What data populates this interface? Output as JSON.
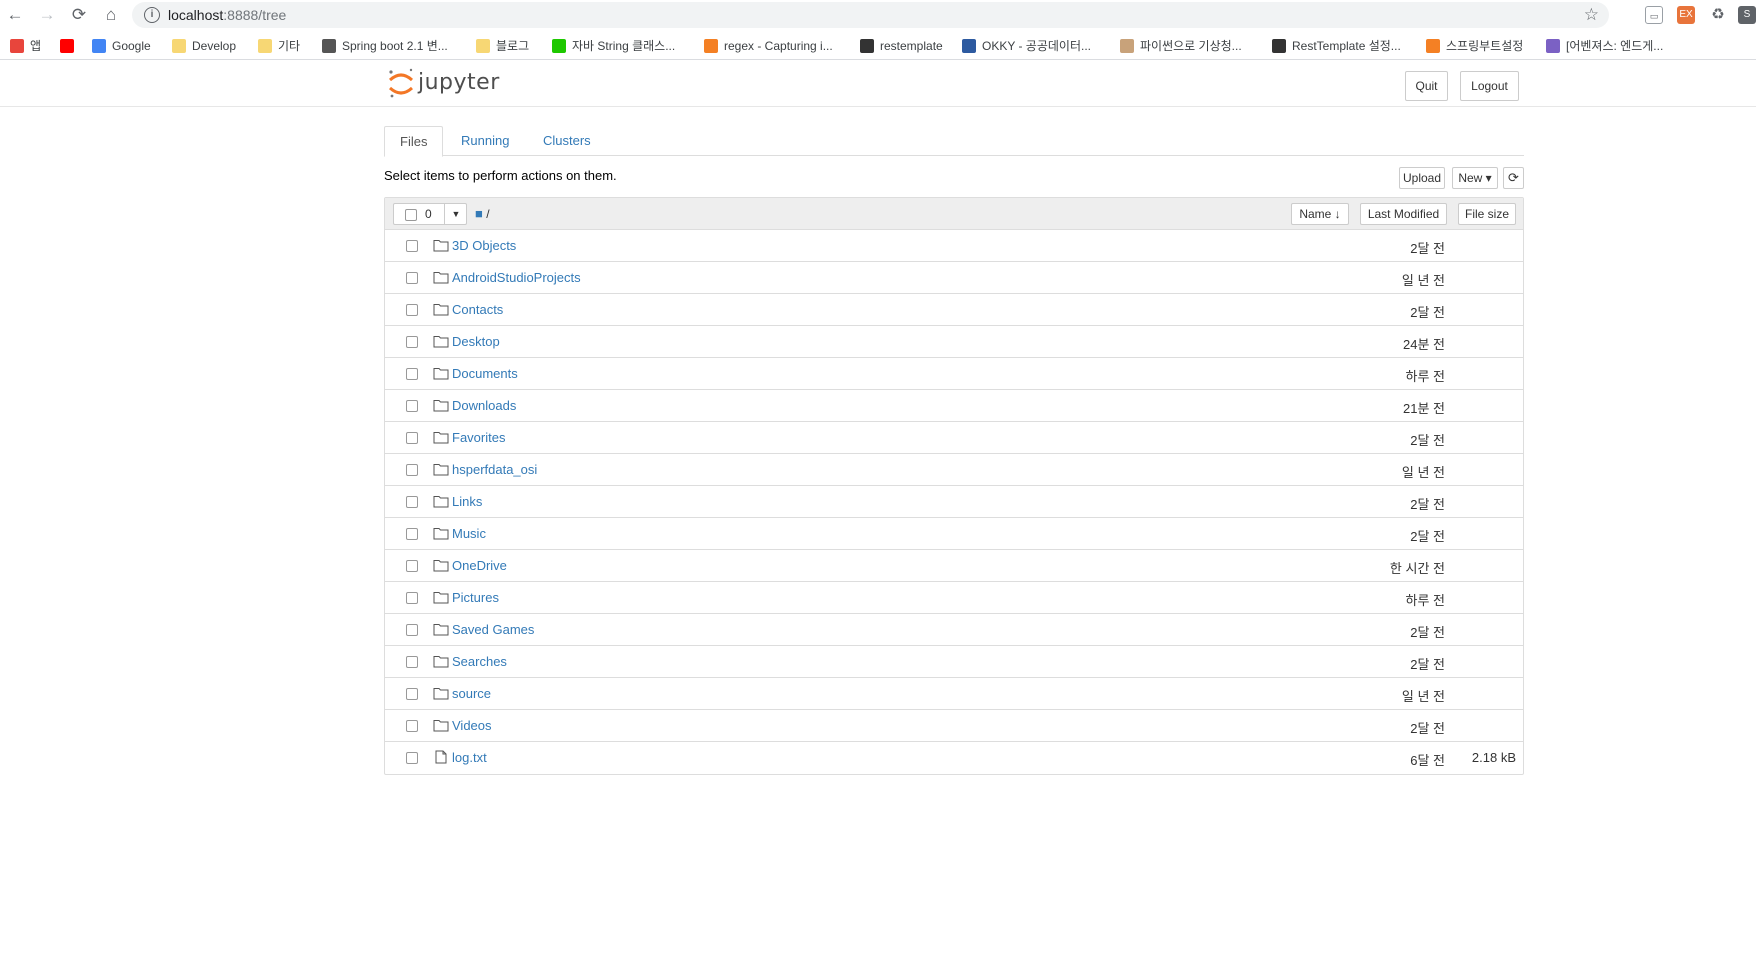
{
  "browser": {
    "url_host": "localhost",
    "url_rest": ":8888/tree",
    "bookmarks": [
      {
        "label": "앱",
        "icon": "apps-grid-icon",
        "color": "#e8453c"
      },
      {
        "label": "",
        "icon": "youtube-icon",
        "color": "#ff0000"
      },
      {
        "label": "Google",
        "icon": "google-icon",
        "color": "#4285f4"
      },
      {
        "label": "Develop",
        "icon": "folder-icon",
        "color": "#f7d774"
      },
      {
        "label": "기타",
        "icon": "folder-icon",
        "color": "#f7d774"
      },
      {
        "label": "Spring boot 2.1 변...",
        "icon": "globe-icon",
        "color": "#555555"
      },
      {
        "label": "블로그",
        "icon": "folder-icon",
        "color": "#f7d774"
      },
      {
        "label": "자바 String 클래스...",
        "icon": "naver-icon",
        "color": "#1ec800"
      },
      {
        "label": "regex - Capturing i...",
        "icon": "stackoverflow-icon",
        "color": "#f48024"
      },
      {
        "label": "restemplate",
        "icon": "tree-icon",
        "color": "#333333"
      },
      {
        "label": "OKKY - 공공데이터...",
        "icon": "okky-icon",
        "color": "#2d5aa0"
      },
      {
        "label": "파이썬으로 기상청...",
        "icon": "blog-icon",
        "color": "#c8a27a"
      },
      {
        "label": "RestTemplate 설정...",
        "icon": "tree-icon",
        "color": "#333333"
      },
      {
        "label": "스프링부트설정",
        "icon": "stackoverflow-icon",
        "color": "#f48024"
      },
      {
        "label": "[어벤져스: 엔드게...",
        "icon": "flower-icon",
        "color": "#7b61c4"
      }
    ]
  },
  "header": {
    "logo_text": "jupyter",
    "quit_label": "Quit",
    "logout_label": "Logout"
  },
  "tabs": [
    {
      "label": "Files",
      "active": true
    },
    {
      "label": "Running",
      "active": false
    },
    {
      "label": "Clusters",
      "active": false
    }
  ],
  "toolbar": {
    "instructions": "Select items to perform actions on them.",
    "upload_label": "Upload",
    "new_label": "New ▾",
    "refresh_icon": "refresh-icon"
  },
  "list": {
    "selected_count": "0",
    "breadcrumb": "/",
    "sort_name_label": "Name ↓",
    "sort_modified_label": "Last Modified",
    "sort_size_label": "File size",
    "rows": [
      {
        "type": "folder",
        "name": "3D Objects",
        "modified": "2달 전",
        "size": ""
      },
      {
        "type": "folder",
        "name": "AndroidStudioProjects",
        "modified": "일 년 전",
        "size": ""
      },
      {
        "type": "folder",
        "name": "Contacts",
        "modified": "2달 전",
        "size": ""
      },
      {
        "type": "folder",
        "name": "Desktop",
        "modified": "24분 전",
        "size": ""
      },
      {
        "type": "folder",
        "name": "Documents",
        "modified": "하루 전",
        "size": ""
      },
      {
        "type": "folder",
        "name": "Downloads",
        "modified": "21분 전",
        "size": ""
      },
      {
        "type": "folder",
        "name": "Favorites",
        "modified": "2달 전",
        "size": ""
      },
      {
        "type": "folder",
        "name": "hsperfdata_osi",
        "modified": "일 년 전",
        "size": ""
      },
      {
        "type": "folder",
        "name": "Links",
        "modified": "2달 전",
        "size": ""
      },
      {
        "type": "folder",
        "name": "Music",
        "modified": "2달 전",
        "size": ""
      },
      {
        "type": "folder",
        "name": "OneDrive",
        "modified": "한 시간 전",
        "size": ""
      },
      {
        "type": "folder",
        "name": "Pictures",
        "modified": "하루 전",
        "size": ""
      },
      {
        "type": "folder",
        "name": "Saved Games",
        "modified": "2달 전",
        "size": ""
      },
      {
        "type": "folder",
        "name": "Searches",
        "modified": "2달 전",
        "size": ""
      },
      {
        "type": "folder",
        "name": "source",
        "modified": "일 년 전",
        "size": ""
      },
      {
        "type": "folder",
        "name": "Videos",
        "modified": "2달 전",
        "size": ""
      },
      {
        "type": "file",
        "name": "log.txt",
        "modified": "6달 전",
        "size": "2.18 kB"
      }
    ]
  }
}
